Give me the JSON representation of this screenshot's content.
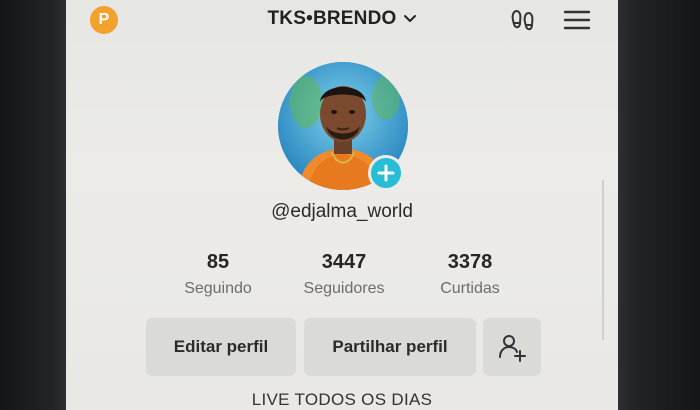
{
  "header": {
    "badge_letter": "P",
    "title": "TKS•BRENDO"
  },
  "profile": {
    "username": "@edjalma_world",
    "stats": [
      {
        "value": "85",
        "label": "Seguindo"
      },
      {
        "value": "3447",
        "label": "Seguidores"
      },
      {
        "value": "3378",
        "label": "Curtidas"
      }
    ],
    "bio": "LIVE TODOS OS DIAS"
  },
  "actions": {
    "edit_label": "Editar perfil",
    "share_label": "Partilhar perfil"
  },
  "icons": {
    "header_left": "p-badge-icon",
    "header_right_1": "footprints-icon",
    "header_right_2": "hamburger-menu-icon",
    "avatar_badge": "plus-icon",
    "add_friend": "add-user-icon"
  },
  "colors": {
    "badge": "#f2a22c",
    "add_badge": "#27bdd6",
    "button_bg": "#dadad7"
  }
}
